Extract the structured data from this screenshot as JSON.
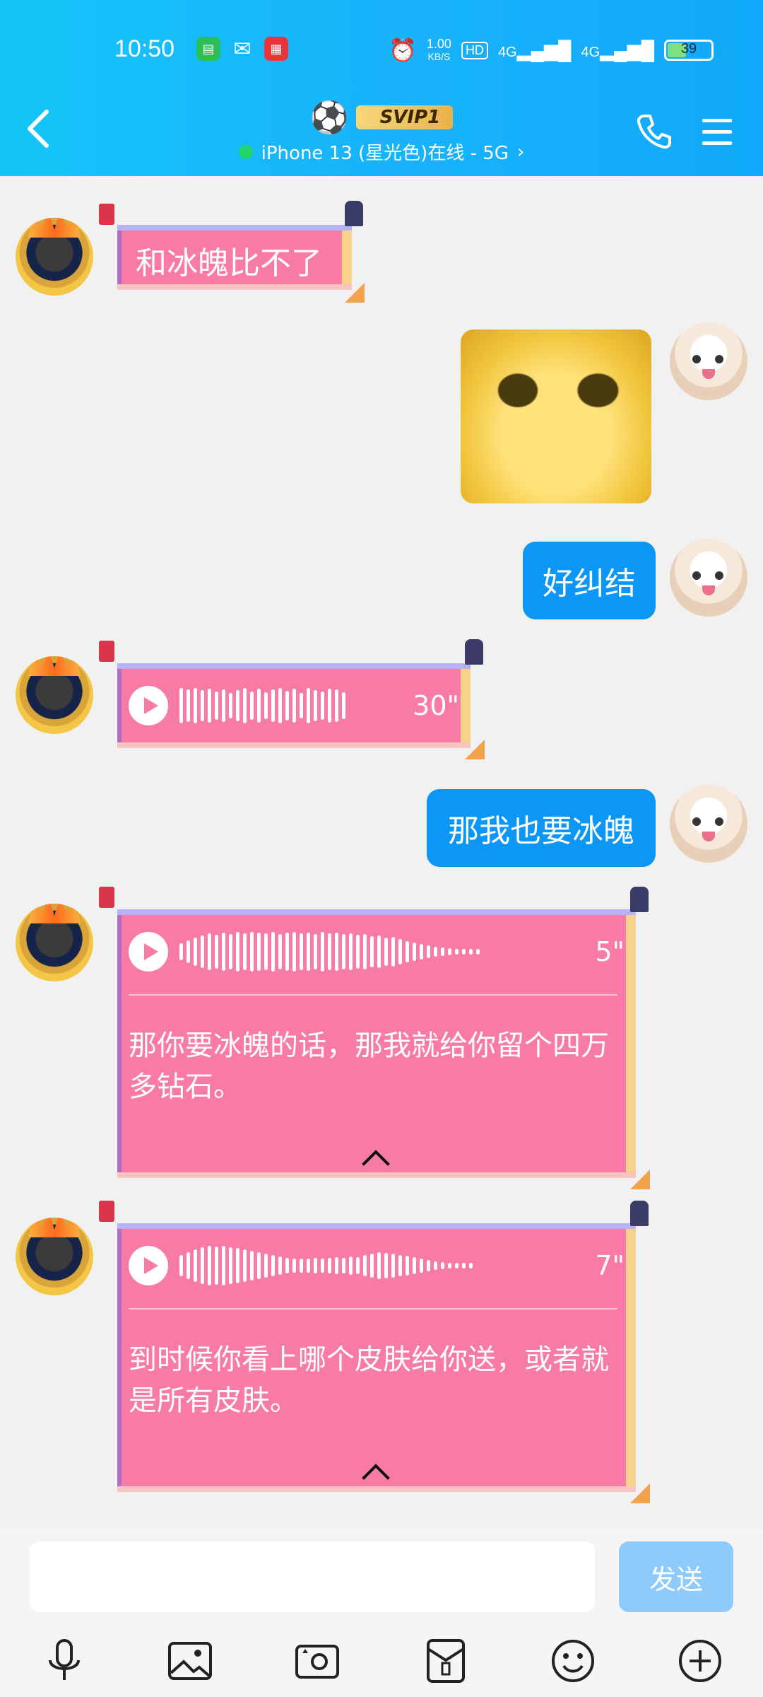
{
  "status_bar": {
    "time": "10:50",
    "net_speed_value": "1.00",
    "net_speed_unit": "KB/S",
    "hd_badge": "HD",
    "signal_1": "4G",
    "signal_2": "4G",
    "battery": "39"
  },
  "header": {
    "title_icon": "soccer-ball",
    "title_emoji": "⚽",
    "vip_badge": "SVIP1",
    "status": "iPhone 13 (星光色)在线 - 5G",
    "status_chevron": "›"
  },
  "messages": [
    {
      "side": "left",
      "type": "text",
      "text": "和冰魄比不了"
    },
    {
      "side": "right",
      "type": "image",
      "image_desc": "yellow-cat-meme"
    },
    {
      "side": "right",
      "type": "text",
      "text": "好纠结"
    },
    {
      "side": "left",
      "type": "voice",
      "duration": "30\""
    },
    {
      "side": "right",
      "type": "text",
      "text": "那我也要冰魄"
    },
    {
      "side": "left",
      "type": "voice",
      "duration": "5\"",
      "transcript": "那你要冰魄的话，那我就给你留个四万多钻石。"
    },
    {
      "side": "left",
      "type": "voice",
      "duration": "7\"",
      "transcript": "到时候你看上哪个皮肤给你送，或者就是所有皮肤。"
    }
  ],
  "composer": {
    "input_value": "",
    "send_label": "发送"
  },
  "toolbar": [
    "mic-icon",
    "image-icon",
    "camera-icon",
    "red-packet-icon",
    "emoji-icon",
    "plus-icon"
  ],
  "colors": {
    "header_gradient_start": "#14c6f8",
    "header_gradient_end": "#10a9fb",
    "bubble_blue": "#0c96f5",
    "bubble_pink": "#f77aa7",
    "send_button": "#8fcbfa",
    "online_dot": "#22d46a"
  }
}
